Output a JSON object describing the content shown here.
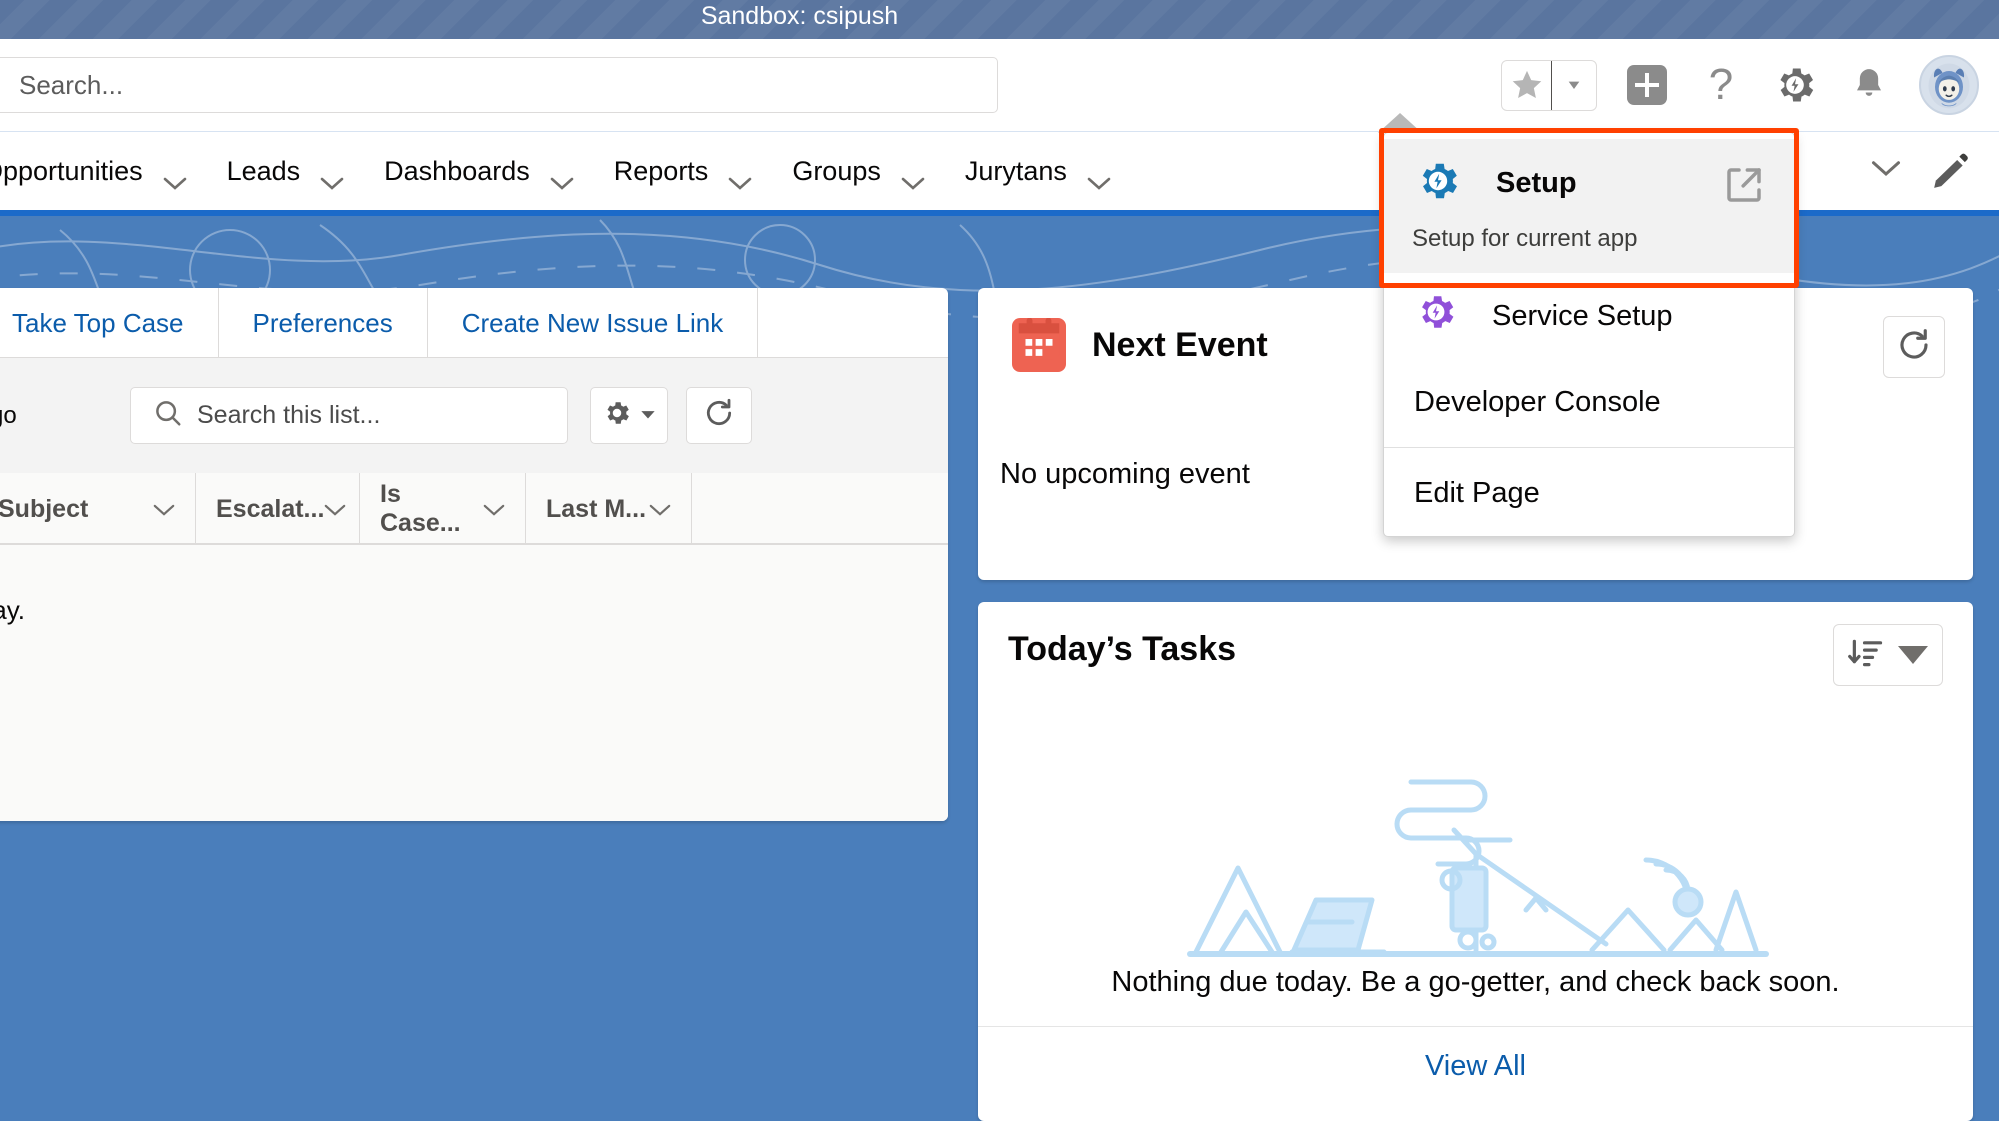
{
  "sandbox": {
    "label": "Sandbox: csipush"
  },
  "global_header": {
    "search": {
      "placeholder": "Search...",
      "value": ""
    },
    "icons": [
      {
        "name": "favorites-star-icon",
        "glyph": "star"
      },
      {
        "name": "favorites-caret-icon",
        "glyph": "caret-down"
      },
      {
        "name": "global-actions-plus-icon",
        "glyph": "plus"
      },
      {
        "name": "help-question-icon",
        "glyph": "question"
      },
      {
        "name": "setup-gear-icon",
        "glyph": "gear"
      },
      {
        "name": "notifications-bell-icon",
        "glyph": "bell"
      },
      {
        "name": "user-avatar",
        "glyph": "avatar"
      }
    ]
  },
  "navbar": {
    "items": [
      {
        "label": "Opportunities",
        "has_caret": true
      },
      {
        "label": "Leads",
        "has_caret": true
      },
      {
        "label": "Dashboards",
        "has_caret": true
      },
      {
        "label": "Reports",
        "has_caret": true
      },
      {
        "label": "Groups",
        "has_caret": true
      },
      {
        "label": "Jurytans",
        "has_caret": true
      }
    ],
    "edit_pencil": "pencil-icon"
  },
  "setup_menu": {
    "primary": {
      "label": "Setup",
      "sublabel": "Setup for current app",
      "icon": "setup-gear-icon-blue",
      "external_icon": "external-link-icon",
      "icon_color": "#1b7ab5"
    },
    "items": [
      {
        "label": "Service Setup",
        "icon": "service-setup-gear-icon",
        "icon_color": "#9050d9",
        "has_icon": true
      },
      {
        "label": "Developer Console",
        "has_icon": false
      }
    ],
    "footer_items": [
      {
        "label": "Edit Page",
        "has_icon": false
      }
    ],
    "highlight_color": "#ff4000"
  },
  "left_panel": {
    "actions": [
      {
        "label": "Take Top Case"
      },
      {
        "label": "Preferences"
      },
      {
        "label": "Create New Issue Link"
      }
    ],
    "toolbar": {
      "ago_text": "go",
      "search_placeholder": "Search this list...",
      "search_value": "",
      "settings_icon": "gear-icon",
      "refresh_icon": "refresh-icon"
    },
    "table": {
      "columns": [
        "Subject",
        "Escalat...",
        "Is Case...",
        "Last M..."
      ],
      "empty_message": "play.",
      "rows": []
    }
  },
  "next_event": {
    "title": "Next Event",
    "icon": "calendar-icon",
    "icon_color": "#ee6352",
    "empty_text": "No upcoming event",
    "refresh_icon": "refresh-icon"
  },
  "todays_tasks": {
    "title": "Today’s Tasks",
    "sort_icon": "sort-descending-icon",
    "caret_icon": "caret-down-icon",
    "empty_message": "Nothing due today. Be a go-getter, and check back soon.",
    "view_all_label": "View All",
    "illustration": "desert-campsite-illustration"
  },
  "colors": {
    "sandbox_band": "#5a759f",
    "page_band": "#4a7ebb",
    "link": "#0b5cab",
    "brand_blue": "#1b7ab5",
    "purple": "#9050d9"
  }
}
